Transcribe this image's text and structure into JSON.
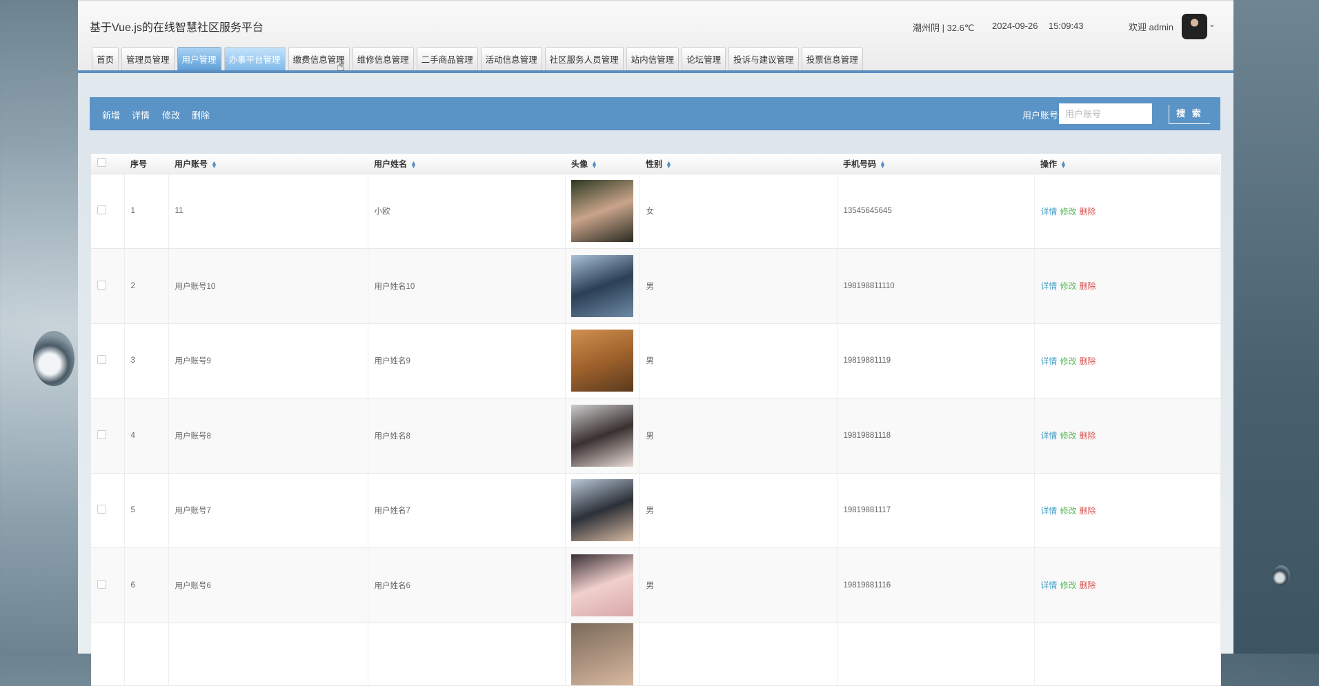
{
  "header": {
    "title": "基于Vue.js的在线智慧社区服务平台",
    "weather": "潮州阴 | 32.6℃",
    "date": "2024-09-26",
    "time": "15:09:43",
    "welcome": "欢迎 admin"
  },
  "nav": {
    "active": "用户管理",
    "hovered": "办事平台管理",
    "tabs": [
      "首页",
      "管理员管理",
      "用户管理",
      "办事平台管理",
      "缴费信息管理",
      "维修信息管理",
      "二手商品管理",
      "活动信息管理",
      "社区服务人员管理",
      "站内信管理",
      "论坛管理",
      "投诉与建议管理",
      "投票信息管理"
    ]
  },
  "toolbar": {
    "add": "新增",
    "detail": "详情",
    "edit": "修改",
    "delete": "删除",
    "search_label": "用户账号:",
    "search_placeholder": "用户账号",
    "search_value": "",
    "search_button": "搜 索"
  },
  "table": {
    "columns": [
      "序号",
      "用户账号",
      "用户姓名",
      "头像",
      "性别",
      "手机号码",
      "操作"
    ],
    "actions": {
      "detail": "详情",
      "edit": "修改",
      "delete": "删除"
    },
    "rows": [
      {
        "no": "1",
        "account": "11",
        "name": "小欧",
        "gender": "女",
        "phone": "13545645645"
      },
      {
        "no": "2",
        "account": "用户账号10",
        "name": "用户姓名10",
        "gender": "男",
        "phone": "198198811110"
      },
      {
        "no": "3",
        "account": "用户账号9",
        "name": "用户姓名9",
        "gender": "男",
        "phone": "19819881119"
      },
      {
        "no": "4",
        "account": "用户账号8",
        "name": "用户姓名8",
        "gender": "男",
        "phone": "19819881118"
      },
      {
        "no": "5",
        "account": "用户账号7",
        "name": "用户姓名7",
        "gender": "男",
        "phone": "19819881117"
      },
      {
        "no": "6",
        "account": "用户账号6",
        "name": "用户姓名6",
        "gender": "男",
        "phone": "19819881116"
      }
    ]
  },
  "colors": {
    "accent": "#5a93c6",
    "detail": "#4aa3c9",
    "edit": "#5cb85c",
    "delete": "#d9534f"
  }
}
